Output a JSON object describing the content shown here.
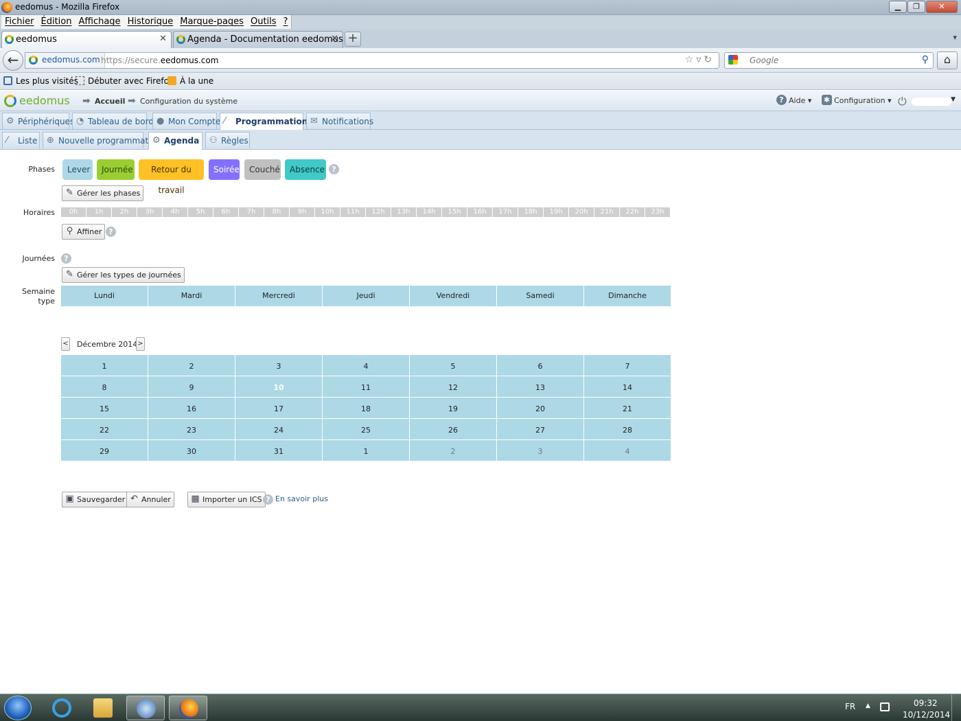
{
  "window": {
    "title": "eedomus - Mozilla Firefox",
    "minimize": "▁",
    "maximize": "❐",
    "close": "✕"
  },
  "menubar": [
    "Fichier",
    "Édition",
    "Affichage",
    "Historique",
    "Marque-pages",
    "Outils",
    "?"
  ],
  "tabs": [
    {
      "label": "eedomus",
      "close": "✕"
    },
    {
      "label": "Agenda - Documentation eedomus",
      "close": "✕"
    }
  ],
  "new_tab": "+",
  "tab_list": "▾",
  "navbar": {
    "site_identity": "eedomus.com",
    "url_prefix": "https://secure.",
    "url_domain": "eedomus.com",
    "url_icons": "☆▿↻",
    "search_placeholder": "Google",
    "back": "←",
    "home": "⌂",
    "search_icon": "⚲"
  },
  "bookmarks": [
    "Les plus visités",
    "Débuter avec Firefox",
    "À la une"
  ],
  "app": {
    "logo": "eedomus",
    "breadcrumb": [
      "Accueil",
      "Configuration du système"
    ],
    "help_menu": "Aide ▾",
    "config_menu": "Configuration ▾",
    "main_tabs": [
      "Périphériques",
      "Tableau de bord",
      "Mon Compte",
      "Programmation",
      "Notifications"
    ],
    "sub_tabs": [
      "Liste",
      "Nouvelle programmation",
      "Agenda",
      "Règles"
    ]
  },
  "labels": {
    "phases": "Phases",
    "horaires": "Horaires",
    "journees": "Journées",
    "semaine_type_1": "Semaine",
    "semaine_type_2": "type"
  },
  "phases": [
    {
      "name": "Lever",
      "color": "#add8e6",
      "text_color": "#2a4a66"
    },
    {
      "name": "Journée",
      "color": "#9acd32",
      "text_color": "#2a4a10"
    },
    {
      "name": "Retour du travail",
      "color": "#ffc125",
      "text_color": "#4a3000"
    },
    {
      "name": "Soirée",
      "color": "#8470ff",
      "text_color": "#ffffff"
    },
    {
      "name": "Couché",
      "color": "#c0c0c0",
      "text_color": "#333333"
    },
    {
      "name": "Absence",
      "color": "#40c9c6",
      "text_color": "#0c3a3a"
    }
  ],
  "buttons": {
    "manage_phases": "Gérer les phases",
    "refine": "Affiner",
    "manage_day_types": "Gérer les types de journées",
    "save": "Sauvegarder",
    "cancel": "Annuler",
    "import_ics": "Importer un ICS",
    "learn_more": "En savoir plus"
  },
  "hours": [
    "0h",
    "1h",
    "2h",
    "3h",
    "4h",
    "5h",
    "6h",
    "7h",
    "8h",
    "9h",
    "10h",
    "11h",
    "12h",
    "13h",
    "14h",
    "15h",
    "16h",
    "17h",
    "18h",
    "19h",
    "20h",
    "21h",
    "22h",
    "23h"
  ],
  "week_days": [
    "Lundi",
    "Mardi",
    "Mercredi",
    "Jeudi",
    "Vendredi",
    "Samedi",
    "Dimanche"
  ],
  "calendar": {
    "month_label": "Décembre 2014",
    "prev": "<",
    "next": ">",
    "today": "10",
    "weeks": [
      [
        "1",
        "2",
        "3",
        "4",
        "5",
        "6",
        "7"
      ],
      [
        "8",
        "9",
        "10",
        "11",
        "12",
        "13",
        "14"
      ],
      [
        "15",
        "16",
        "17",
        "18",
        "19",
        "20",
        "21"
      ],
      [
        "22",
        "23",
        "24",
        "25",
        "26",
        "27",
        "28"
      ],
      [
        "29",
        "30",
        "31",
        "1",
        "2",
        "3",
        "4"
      ]
    ],
    "other_month_cells": [
      [
        4,
        4
      ],
      [
        4,
        5
      ],
      [
        4,
        6
      ]
    ]
  },
  "taskbar": {
    "language": "FR",
    "time": "09:32",
    "date": "10/12/2014"
  }
}
